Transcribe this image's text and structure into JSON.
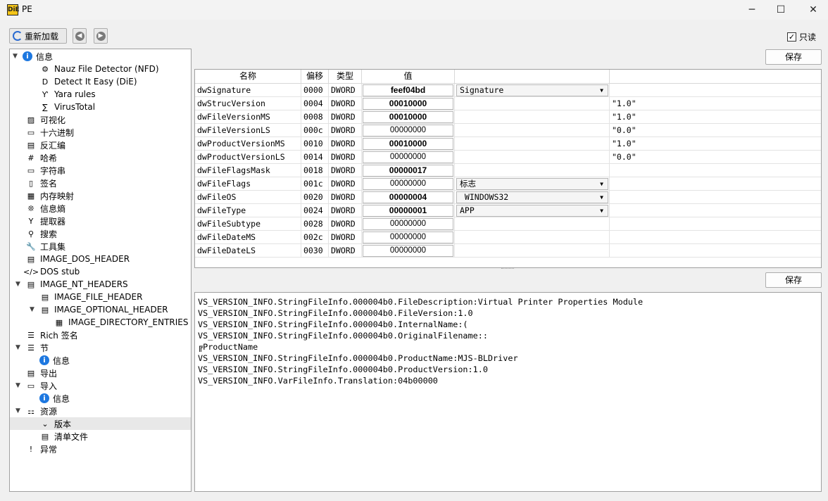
{
  "window": {
    "title": "PE",
    "app_icon": "DiE",
    "minimize": "─",
    "maximize": "☐",
    "close": "✕"
  },
  "toolbar": {
    "reload_label": "重新加载",
    "back_icon": "◀",
    "forward_icon": "▶",
    "readonly_label": "只读",
    "readonly_checked": "✓"
  },
  "tree": {
    "items": [
      {
        "label": "信息",
        "icon": "info-icon",
        "glyph": "i"
      },
      {
        "label": "Nauz File Detector (NFD)",
        "icon": "nfd-icon",
        "glyph": "⚙"
      },
      {
        "label": "Detect It Easy (DiE)",
        "icon": "die-icon",
        "glyph": "D"
      },
      {
        "label": "Yara rules",
        "icon": "yara-icon",
        "glyph": "Ƴ"
      },
      {
        "label": "VirusTotal",
        "icon": "virustotal-icon",
        "glyph": "∑"
      },
      {
        "label": "可视化",
        "icon": "image-icon",
        "glyph": "▨"
      },
      {
        "label": "十六进制",
        "icon": "hex-icon",
        "glyph": "▭"
      },
      {
        "label": "反汇编",
        "icon": "disasm-icon",
        "glyph": "▤"
      },
      {
        "label": "哈希",
        "icon": "hash-icon",
        "glyph": "#"
      },
      {
        "label": "字符串",
        "icon": "strings-icon",
        "glyph": "▭"
      },
      {
        "label": "签名",
        "icon": "signature-icon",
        "glyph": "▯"
      },
      {
        "label": "内存映射",
        "icon": "memory-map-icon",
        "glyph": "▦"
      },
      {
        "label": "信息熵",
        "icon": "entropy-icon",
        "glyph": "❊"
      },
      {
        "label": "提取器",
        "icon": "extractor-icon",
        "glyph": "Y"
      },
      {
        "label": "搜索",
        "icon": "search-icon",
        "glyph": "⚲"
      },
      {
        "label": "工具集",
        "icon": "tools-icon",
        "glyph": "🔧"
      },
      {
        "label": "IMAGE_DOS_HEADER",
        "icon": "header-icon",
        "glyph": "▤"
      },
      {
        "label": "DOS stub",
        "icon": "code-icon",
        "glyph": "</>"
      },
      {
        "label": "IMAGE_NT_HEADERS",
        "icon": "header-icon",
        "glyph": "▤"
      },
      {
        "label": "IMAGE_FILE_HEADER",
        "icon": "header-icon",
        "glyph": "▤"
      },
      {
        "label": "IMAGE_OPTIONAL_HEADER",
        "icon": "header-icon",
        "glyph": "▤"
      },
      {
        "label": "IMAGE_DIRECTORY_ENTRIES",
        "icon": "table-icon",
        "glyph": "▦"
      },
      {
        "label": "Rich 签名",
        "icon": "list-icon",
        "glyph": "☰"
      },
      {
        "label": "节",
        "icon": "sections-icon",
        "glyph": "☰"
      },
      {
        "label": "信息",
        "icon": "info-icon",
        "glyph": "i"
      },
      {
        "label": "导出",
        "icon": "export-icon",
        "glyph": "▤"
      },
      {
        "label": "导入",
        "icon": "import-icon",
        "glyph": "▭"
      },
      {
        "label": "信息",
        "icon": "info-icon",
        "glyph": "i"
      },
      {
        "label": "资源",
        "icon": "resources-icon",
        "glyph": "⚏"
      },
      {
        "label": "版本",
        "icon": "version-icon",
        "glyph": "⌄"
      },
      {
        "label": "清单文件",
        "icon": "manifest-icon",
        "glyph": "▤"
      },
      {
        "label": "异常",
        "icon": "exception-icon",
        "glyph": "!"
      }
    ]
  },
  "save_label": "保存",
  "grid": {
    "columns": [
      "名称",
      "偏移",
      "类型",
      "值",
      "",
      ""
    ],
    "rows": [
      {
        "name": "dwSignature",
        "offset": "0000",
        "type": "DWORD",
        "value": "feef04bd",
        "bold": true,
        "combo": "Signature",
        "extra": ""
      },
      {
        "name": "dwStrucVersion",
        "offset": "0004",
        "type": "DWORD",
        "value": "00010000",
        "bold": true,
        "combo": "",
        "extra": "\"1.0\""
      },
      {
        "name": "dwFileVersionMS",
        "offset": "0008",
        "type": "DWORD",
        "value": "00010000",
        "bold": true,
        "combo": "",
        "extra": "\"1.0\""
      },
      {
        "name": "dwFileVersionLS",
        "offset": "000c",
        "type": "DWORD",
        "value": "00000000",
        "bold": false,
        "combo": "",
        "extra": "\"0.0\""
      },
      {
        "name": "dwProductVersionMS",
        "offset": "0010",
        "type": "DWORD",
        "value": "00010000",
        "bold": true,
        "combo": "",
        "extra": "\"1.0\""
      },
      {
        "name": "dwProductVersionLS",
        "offset": "0014",
        "type": "DWORD",
        "value": "00000000",
        "bold": false,
        "combo": "",
        "extra": "\"0.0\""
      },
      {
        "name": "dwFileFlagsMask",
        "offset": "0018",
        "type": "DWORD",
        "value": "00000017",
        "bold": true,
        "combo": "",
        "extra": ""
      },
      {
        "name": "dwFileFlags",
        "offset": "001c",
        "type": "DWORD",
        "value": "00000000",
        "bold": false,
        "combo": "标志",
        "extra": ""
      },
      {
        "name": "dwFileOS",
        "offset": "0020",
        "type": "DWORD",
        "value": "00000004",
        "bold": true,
        "combo": " WINDOWS32",
        "extra": ""
      },
      {
        "name": "dwFileType",
        "offset": "0024",
        "type": "DWORD",
        "value": "00000001",
        "bold": true,
        "combo": "APP",
        "extra": ""
      },
      {
        "name": "dwFileSubtype",
        "offset": "0028",
        "type": "DWORD",
        "value": "00000000",
        "bold": false,
        "combo": "",
        "extra": ""
      },
      {
        "name": "dwFileDateMS",
        "offset": "002c",
        "type": "DWORD",
        "value": "00000000",
        "bold": false,
        "combo": "",
        "extra": ""
      },
      {
        "name": "dwFileDateLS",
        "offset": "0030",
        "type": "DWORD",
        "value": "00000000",
        "bold": false,
        "combo": "",
        "extra": ""
      }
    ]
  },
  "strings_panel": {
    "lines": [
      "VS_VERSION_INFO.StringFileInfo.000004b0.FileDescription:Virtual Printer Properties Module",
      "VS_VERSION_INFO.StringFileInfo.000004b0.FileVersion:1.0",
      "VS_VERSION_INFO.StringFileInfo.000004b0.InternalName:(",
      "VS_VERSION_INFO.StringFileInfo.000004b0.OriginalFilename::",
      "╔ProductName",
      "VS_VERSION_INFO.StringFileInfo.000004b0.ProductName:MJS-BLDriver",
      "VS_VERSION_INFO.StringFileInfo.000004b0.ProductVersion:1.0",
      "VS_VERSION_INFO.VarFileInfo.Translation:04b00000"
    ]
  },
  "combo_arrow": "▼"
}
